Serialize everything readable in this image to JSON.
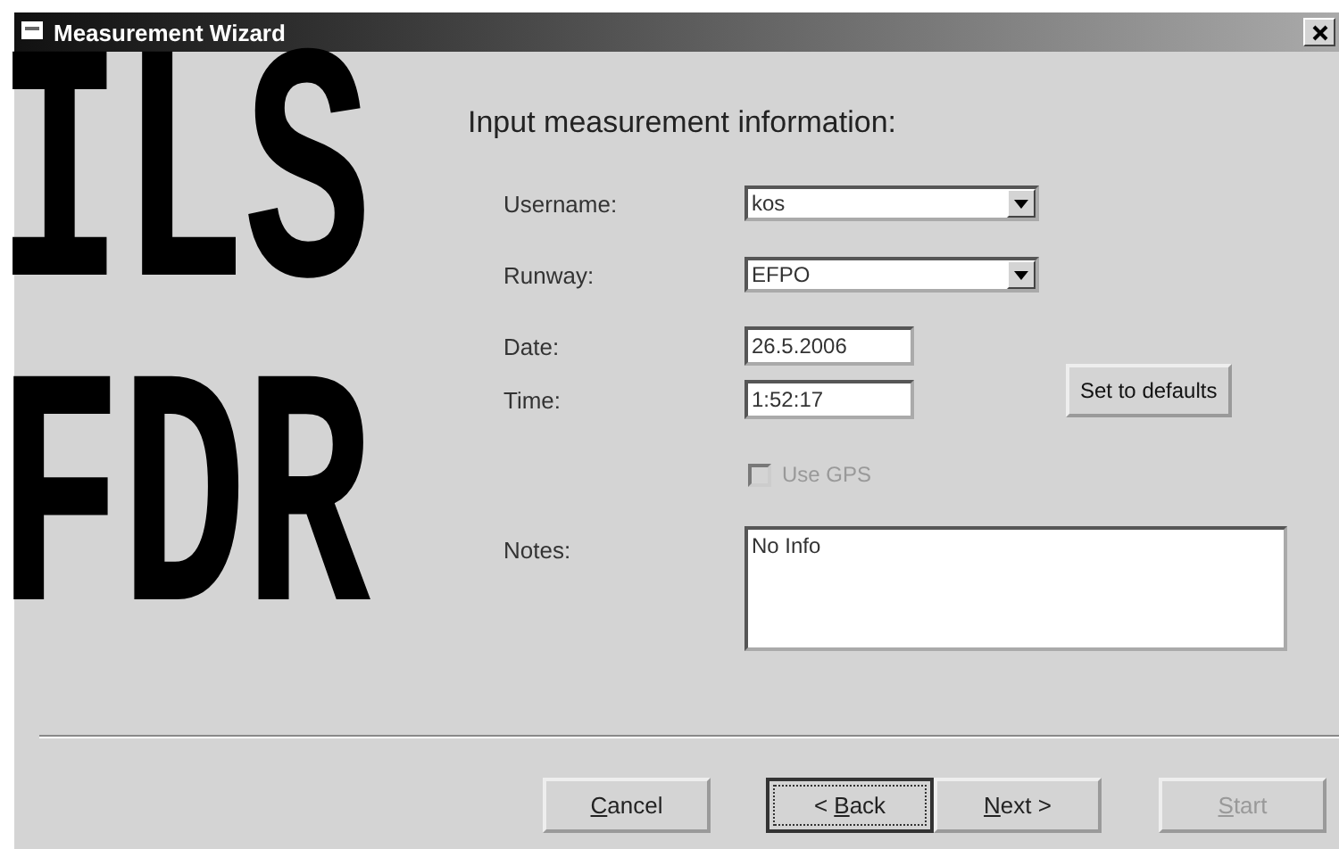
{
  "window": {
    "title": "Measurement Wizard"
  },
  "logo": {
    "lines": [
      "ILS",
      "FDR"
    ]
  },
  "heading": "Input measurement information:",
  "fields": [
    {
      "kind": "combo",
      "label": "Username:",
      "value": "kos"
    },
    {
      "kind": "combo",
      "label": "Runway:",
      "value": "EFPO"
    },
    {
      "kind": "text",
      "label": "Date:",
      "value": "26.5.2006"
    },
    {
      "kind": "text",
      "label": "Time:",
      "value": "1:52:17"
    }
  ],
  "defaults_button": "Set to defaults",
  "use_gps": {
    "label": "Use GPS",
    "checked": false,
    "disabled": true
  },
  "notes": {
    "label": "Notes:",
    "value": "No Info"
  },
  "buttons": [
    {
      "key": "C",
      "after": "ancel",
      "disabled": false,
      "focused": false
    },
    {
      "before": "< ",
      "key": "B",
      "after": "ack",
      "disabled": false,
      "focused": true
    },
    {
      "key": "N",
      "after": "ext >",
      "disabled": false,
      "focused": false
    },
    {
      "key": "S",
      "after": "tart",
      "disabled": true,
      "focused": false
    }
  ]
}
